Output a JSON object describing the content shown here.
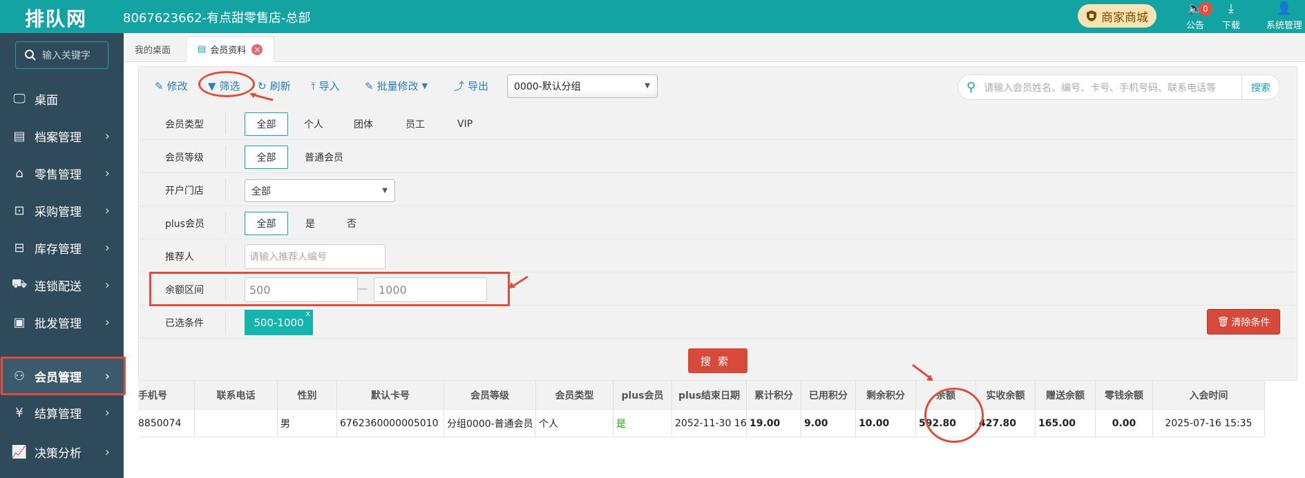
{
  "topbar": {
    "logo": "排队网",
    "store_title": "8067623662-有点甜零售店-总部",
    "mall_label": "商家商城",
    "notice_label": "公告",
    "notice_count": "0",
    "download_label": "下载",
    "system_label": "系统管理"
  },
  "sidebar": {
    "search_placeholder": "输入关键字",
    "items": [
      {
        "label": "桌面",
        "icon": "monitor-icon"
      },
      {
        "label": "档案管理",
        "icon": "file-icon"
      },
      {
        "label": "零售管理",
        "icon": "store-icon"
      },
      {
        "label": "采购管理",
        "icon": "cart-icon"
      },
      {
        "label": "库存管理",
        "icon": "warehouse-icon"
      },
      {
        "label": "连锁配送",
        "icon": "truck-icon"
      },
      {
        "label": "批发管理",
        "icon": "wholesale-icon"
      },
      {
        "label": "会员管理",
        "icon": "user-icon"
      },
      {
        "label": "结算管理",
        "icon": "wallet-icon"
      },
      {
        "label": "决策分析",
        "icon": "chart-icon"
      }
    ]
  },
  "tabs": {
    "desktop": "我的桌面",
    "member": "会员资料",
    "close_glyph": "×"
  },
  "toolbar": {
    "edit": "修改",
    "filter": "筛选",
    "refresh": "刷新",
    "import": "导入",
    "batch_edit": "批量修改",
    "export": "导出",
    "group_value": "0000-默认分组",
    "search_placeholder": "请输入会员姓名、编号、卡号、手机号码、联系电话等",
    "search_button": "搜索"
  },
  "filters": {
    "member_type": {
      "label": "会员类型",
      "options": [
        "全部",
        "个人",
        "团体",
        "员工",
        "VIP"
      ]
    },
    "member_level": {
      "label": "会员等级",
      "options": [
        "全部",
        "普通会员"
      ]
    },
    "open_store": {
      "label": "开户门店",
      "value": "全部"
    },
    "plus_member": {
      "label": "plus会员",
      "options": [
        "全部",
        "是",
        "否"
      ]
    },
    "referrer": {
      "label": "推荐人",
      "placeholder": "请输入推荐人编号"
    },
    "balance_range": {
      "label": "余额区间",
      "min": "500",
      "dash": "—",
      "max": "1000"
    },
    "selected": {
      "label": "已选条件",
      "chip": "500-1000",
      "chip_close": "x"
    },
    "clear_button": "清除条件",
    "search_button": "搜索"
  },
  "table": {
    "headers": [
      "手机号",
      "联系电话",
      "性别",
      "默认卡号",
      "会员等级",
      "会员类型",
      "plus会员",
      "plus结束日期",
      "累计积分",
      "已用积分",
      "剩余积分",
      "余额",
      "实收余额",
      "赠送余额",
      "零钱余额",
      "入会时间"
    ],
    "rows": [
      [
        "8850074",
        "",
        "男",
        "6762360000005010",
        "分组0000-普通会员",
        "个人",
        "是",
        "2052-11-30 16:",
        "19.00",
        "9.00",
        "10.00",
        "592.80",
        "427.80",
        "165.00",
        "0.00",
        "2025-07-16 15:35"
      ]
    ]
  },
  "colors": {
    "brand": "#14a3a3",
    "sidebar": "#2f4a5b",
    "danger": "#d7493a",
    "annotation": "#e04e3b"
  }
}
